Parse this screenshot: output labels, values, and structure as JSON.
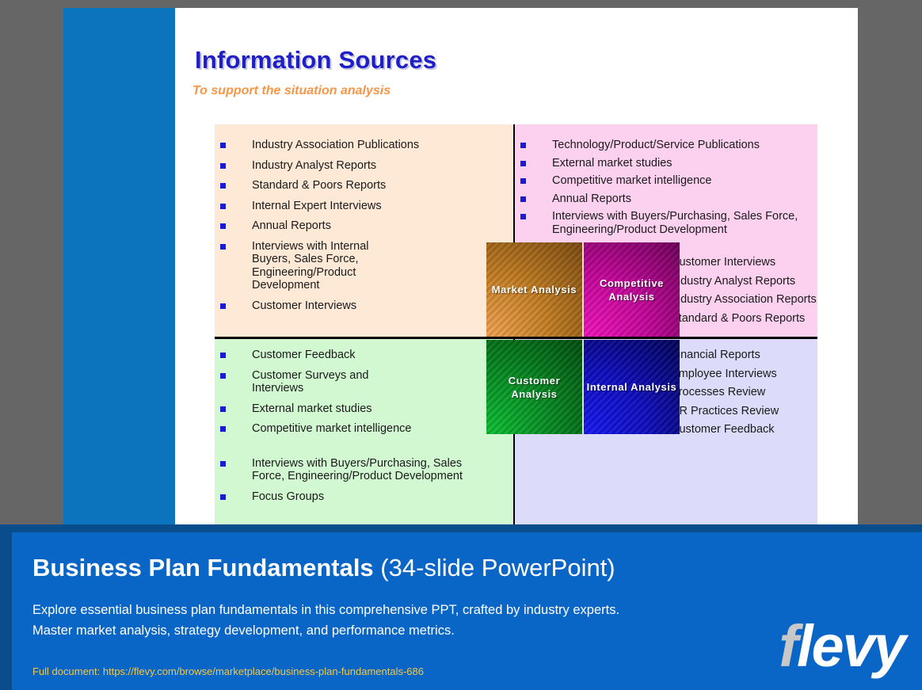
{
  "slide": {
    "title": "Information Sources",
    "subtitle": "To support the situation analysis",
    "colors": {
      "title": "#1f1fc8",
      "subtitle": "#f79646",
      "sidebar_band": "#0c73bd",
      "bullet": "#1a1ad0",
      "quadrant_top_left_bg": "#fde9d6",
      "quadrant_top_right_bg": "#fcd0ef",
      "quadrant_bottom_left_bg": "#d2f8d2",
      "quadrant_bottom_right_bg": "#dcdcfa"
    },
    "quadrants": {
      "top_left": {
        "center_label": "Market\nAnalysis",
        "items": [
          "Industry Association Publications",
          "Industry Analyst Reports",
          "Standard & Poors Reports",
          "Internal Expert Interviews",
          "Annual Reports",
          "Interviews with Internal\nBuyers, Sales Force,\nEngineering/Product\nDevelopment",
          "Customer Interviews"
        ]
      },
      "top_right": {
        "center_label": "Competitive\nAnalysis",
        "items": [
          "Technology/Product/Service Publications",
          "External market studies",
          "Competitive market intelligence",
          "Annual Reports",
          "Interviews with Buyers/Purchasing, Sales Force,\nEngineering/Product Development"
        ],
        "items_secondary": [
          "Customer Interviews",
          "Industry Analyst Reports",
          "Industry Association Reports",
          "Standard & Poors Reports"
        ]
      },
      "bottom_left": {
        "center_label": "Customer\nAnalysis",
        "items": [
          "Customer Feedback",
          "Customer Surveys and\nInterviews",
          "External market studies",
          "Competitive market intelligence",
          "Interviews with Buyers/Purchasing, Sales\nForce, Engineering/Product Development",
          "Focus Groups"
        ]
      },
      "bottom_right": {
        "center_label": "Internal\nAnalysis",
        "items": [
          "Financial Reports",
          "Employee Interviews",
          "Processes Review",
          "HR Practices Review",
          "Customer Feedback"
        ]
      }
    }
  },
  "footer": {
    "title_bold": "Business Plan Fundamentals",
    "title_light": " (34-slide PowerPoint)",
    "description": "Explore essential business plan fundamentals in this comprehensive PPT, crafted by industry experts. Master market analysis, strategy development, and performance metrics.",
    "link": "Full document: https://flevy.com/browse/marketplace/business-plan-fundamentals-686",
    "logo_first": "f",
    "logo_rest": "levy",
    "bg_color": "#0a66c6",
    "border_color": "#0a4d8c",
    "link_color": "#f5c842"
  }
}
